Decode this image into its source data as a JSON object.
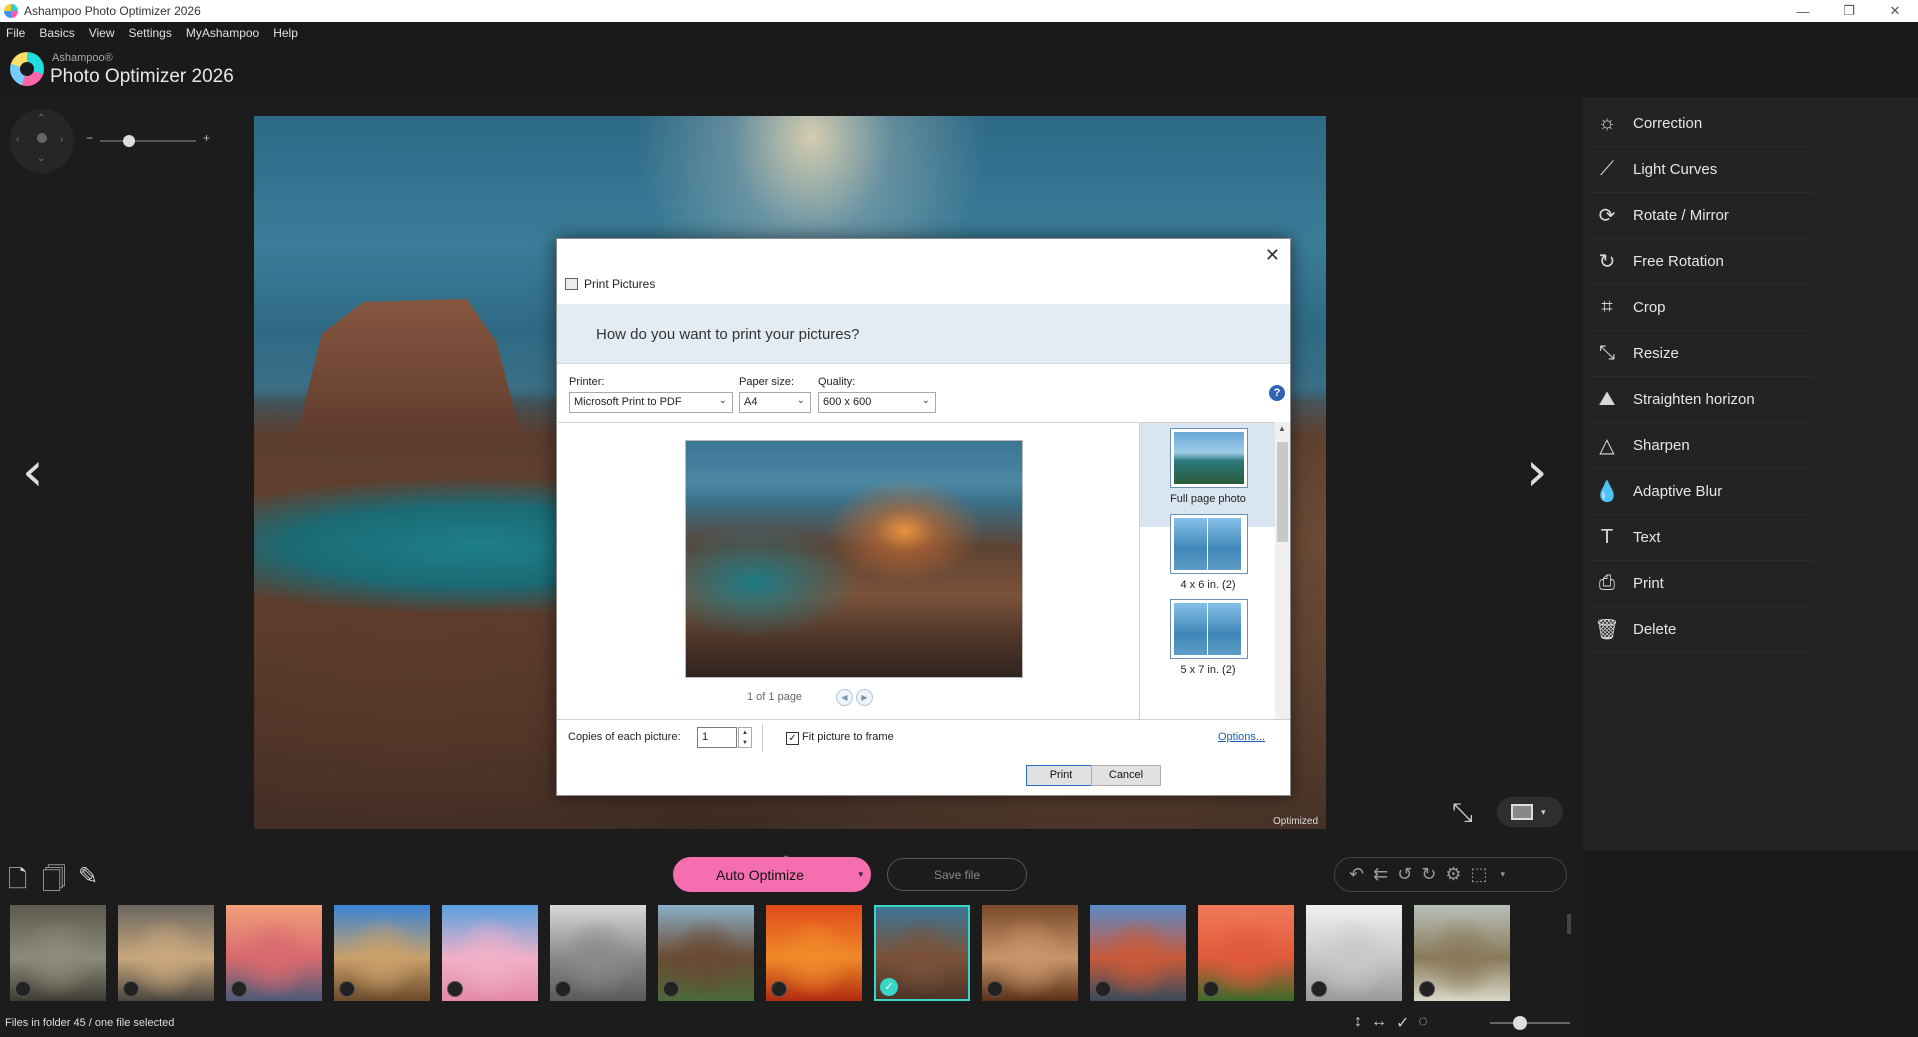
{
  "window": {
    "title": "Ashampoo Photo Optimizer 2026",
    "minimize": "—",
    "restore": "❐",
    "close": "✕"
  },
  "menu": [
    "File",
    "Basics",
    "View",
    "Settings",
    "MyAshampoo",
    "Help"
  ],
  "brand": {
    "small": "Ashampoo®",
    "big": "Photo Optimizer 2026"
  },
  "viewer": {
    "zoom_minus": "−",
    "zoom_plus": "+",
    "zoom_level": 0.3,
    "prev_arrow": "‹",
    "next_arrow": "›",
    "badge": "Optimized"
  },
  "tools": [
    {
      "label": "Correction",
      "icon": "☼",
      "icon_name": "sun-icon"
    },
    {
      "label": "Light Curves",
      "icon": "⟋",
      "icon_name": "curve-icon"
    },
    {
      "label": "Rotate / Mirror",
      "icon": "⟳",
      "icon_name": "rotate-icon"
    },
    {
      "label": "Free Rotation",
      "icon": "↻",
      "icon_name": "free-rotate-icon"
    },
    {
      "label": "Crop",
      "icon": "⌗",
      "icon_name": "crop-icon"
    },
    {
      "label": "Resize",
      "icon": "⤡",
      "icon_name": "resize-icon"
    },
    {
      "label": "Straighten horizon",
      "icon": "⛰",
      "icon_name": "horizon-icon"
    },
    {
      "label": "Sharpen",
      "icon": "△",
      "icon_name": "sharpen-icon"
    },
    {
      "label": "Adaptive Blur",
      "icon": "💧",
      "icon_name": "blur-drop-icon"
    },
    {
      "label": "Text",
      "icon": "T",
      "icon_name": "text-icon"
    },
    {
      "label": "Print",
      "icon": "⎙",
      "icon_name": "printer-icon"
    },
    {
      "label": "Delete",
      "icon": "🗑",
      "icon_name": "trash-icon"
    }
  ],
  "bottombar": {
    "auto_optimize": "Auto Optimize",
    "save_file": "Save file"
  },
  "status": {
    "text": "Files in folder 45 / one file selected"
  },
  "dialog": {
    "title": "Print Pictures",
    "question": "How do you want to print your pictures?",
    "printer_label": "Printer:",
    "printer_value": "Microsoft Print to PDF",
    "paper_label": "Paper size:",
    "paper_value": "A4",
    "quality_label": "Quality:",
    "quality_value": "600 x 600",
    "page_count": "1 of 1 page",
    "layouts": [
      {
        "label": "Full page photo",
        "selected": true
      },
      {
        "label": "4 x 6 in. (2)",
        "selected": false
      },
      {
        "label": "5 x 7 in. (2)",
        "selected": false
      }
    ],
    "copies_label": "Copies of each picture:",
    "copies_value": "1",
    "fit_label": "Fit picture to frame",
    "fit_checked": true,
    "options_link": "Options...",
    "print_button": "Print",
    "cancel_button": "Cancel"
  },
  "filmstrip": [
    {
      "name": "temple-ruins",
      "colors": [
        "#5d5a4e",
        "#8c8b7a",
        "#3f3d33"
      ]
    },
    {
      "name": "cat",
      "colors": [
        "#6b6660",
        "#c9a77d",
        "#4a4640"
      ]
    },
    {
      "name": "sunset-beach",
      "colors": [
        "#f2a07a",
        "#d86a6e",
        "#4a5a78"
      ]
    },
    {
      "name": "desert-tree",
      "colors": [
        "#3a84d6",
        "#c9a06a",
        "#6b4a2a"
      ]
    },
    {
      "name": "pink-lake",
      "colors": [
        "#5aa0e0",
        "#f0b0c8",
        "#e48aa8"
      ]
    },
    {
      "name": "heart-tree",
      "colors": [
        "#d8d8d8",
        "#8a8a8a",
        "#5a5a5a"
      ]
    },
    {
      "name": "horse",
      "colors": [
        "#8ab0c8",
        "#6a4a32",
        "#4a6a3a"
      ]
    },
    {
      "name": "orange-leaf",
      "colors": [
        "#e04a1a",
        "#f08a2a",
        "#b02a10"
      ]
    },
    {
      "name": "canyon",
      "colors": [
        "#3a7594",
        "#7b5239",
        "#4b3428"
      ],
      "selected": true
    },
    {
      "name": "nuts",
      "colors": [
        "#7a4a2a",
        "#c8956a",
        "#5a3018"
      ]
    },
    {
      "name": "coast-town",
      "colors": [
        "#5a8ac8",
        "#c85a3a",
        "#3a4a5a"
      ]
    },
    {
      "name": "orange-flower",
      "colors": [
        "#f07a5a",
        "#e05a3a",
        "#3a6a2a"
      ]
    },
    {
      "name": "foggy-bridge",
      "colors": [
        "#f0f0f0",
        "#c8c8c8",
        "#9a9a9a"
      ]
    },
    {
      "name": "squirrel",
      "colors": [
        "#b8c0b8",
        "#8a7a5a",
        "#d8d8c8"
      ]
    }
  ]
}
